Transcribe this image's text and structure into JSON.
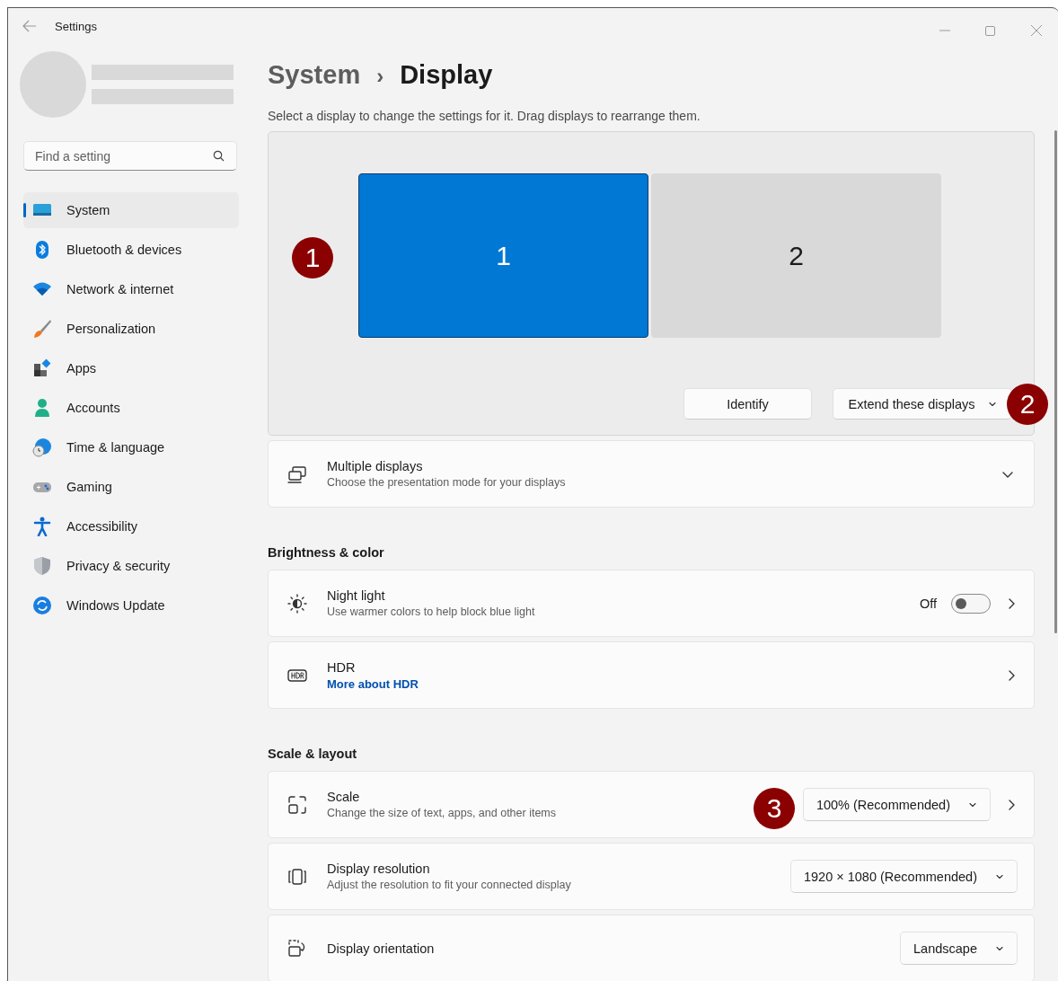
{
  "window": {
    "title": "Settings"
  },
  "sidebar": {
    "search": {
      "placeholder": "Find a setting"
    },
    "items": [
      {
        "label": "System",
        "kind": "system",
        "selected": true
      },
      {
        "label": "Bluetooth & devices",
        "kind": "bluetooth",
        "selected": false
      },
      {
        "label": "Network & internet",
        "kind": "network",
        "selected": false
      },
      {
        "label": "Personalization",
        "kind": "brush",
        "selected": false
      },
      {
        "label": "Apps",
        "kind": "apps",
        "selected": false
      },
      {
        "label": "Accounts",
        "kind": "person",
        "selected": false
      },
      {
        "label": "Time & language",
        "kind": "time",
        "selected": false
      },
      {
        "label": "Gaming",
        "kind": "gamepad",
        "selected": false
      },
      {
        "label": "Accessibility",
        "kind": "accessibility",
        "selected": false
      },
      {
        "label": "Privacy & security",
        "kind": "shield",
        "selected": false
      },
      {
        "label": "Windows Update",
        "kind": "update",
        "selected": false
      }
    ]
  },
  "breadcrumb": {
    "parent": "System",
    "separator": "›",
    "current": "Display"
  },
  "intro": "Select a display to change the settings for it. Drag displays to rearrange them.",
  "arrangement": {
    "callout": "1",
    "monitors": [
      {
        "label": "1",
        "selected": true
      },
      {
        "label": "2",
        "selected": false
      }
    ],
    "identify": "Identify",
    "mode": {
      "value": "Extend these displays",
      "callout": "2"
    }
  },
  "multiple_displays": {
    "title": "Multiple displays",
    "subtitle": "Choose the presentation mode for your displays",
    "expanded": false
  },
  "sections": [
    {
      "heading": "Brightness & color",
      "rows": [
        {
          "kind": "toggle",
          "title": "Night light",
          "subtitle": "Use warmer colors to help block blue light",
          "state_label": "Off",
          "on": false,
          "chevron": true
        },
        {
          "kind": "link",
          "title": "HDR",
          "link": "More about HDR",
          "chevron": true
        }
      ]
    },
    {
      "heading": "Scale & layout",
      "rows": [
        {
          "kind": "dropdown",
          "title": "Scale",
          "subtitle": "Change the size of text, apps, and other items",
          "value": "100% (Recommended)",
          "callout": "3",
          "chevron": true
        },
        {
          "kind": "dropdown",
          "title": "Display resolution",
          "subtitle": "Adjust the resolution to fit your connected display",
          "value": "1920 × 1080 (Recommended)",
          "chevron": false
        },
        {
          "kind": "dropdown",
          "title": "Display orientation",
          "value": "Landscape",
          "chevron": false
        }
      ]
    }
  ]
}
